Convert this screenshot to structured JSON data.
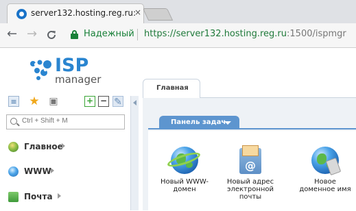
{
  "browser": {
    "tab_title": "server132.hosting.reg.ru:",
    "tab_close": "×",
    "secure_label": "Надежный",
    "url_main": "https://server132.hosting.reg.ru",
    "url_port": ":1500/ispmgr",
    "nav": {
      "back": "←",
      "forward": "→",
      "reload": "C"
    }
  },
  "logo": {
    "brand": "ISP",
    "sub": "manager"
  },
  "sidebar": {
    "tools": {
      "tree": "≡",
      "star": "★",
      "case": "▣",
      "expand": "+",
      "collapse": "−",
      "pin": "✎"
    },
    "search_placeholder": "Ctrl + Shift + M",
    "items": [
      {
        "label": "Главное",
        "icon": "globe-icon"
      },
      {
        "label": "WWW",
        "icon": "globe-icon"
      },
      {
        "label": "Почта",
        "icon": "mail-icon"
      }
    ]
  },
  "main": {
    "tab_label": "Главная",
    "panel_label": "Панель задач",
    "tasks": [
      {
        "line1": "Новый WWW-",
        "line2": "домен",
        "line3": "",
        "icon": "globe-icon"
      },
      {
        "line1": "Новый адрес",
        "line2": "электронной",
        "line3": "почты",
        "icon": "mailbox-icon"
      },
      {
        "line1": "Новое",
        "line2": "доменное имя",
        "line3": "",
        "icon": "domain-icon"
      }
    ]
  },
  "colors": {
    "accent": "#5d95cf",
    "secure": "#188038",
    "logo": "#2a85d0"
  }
}
